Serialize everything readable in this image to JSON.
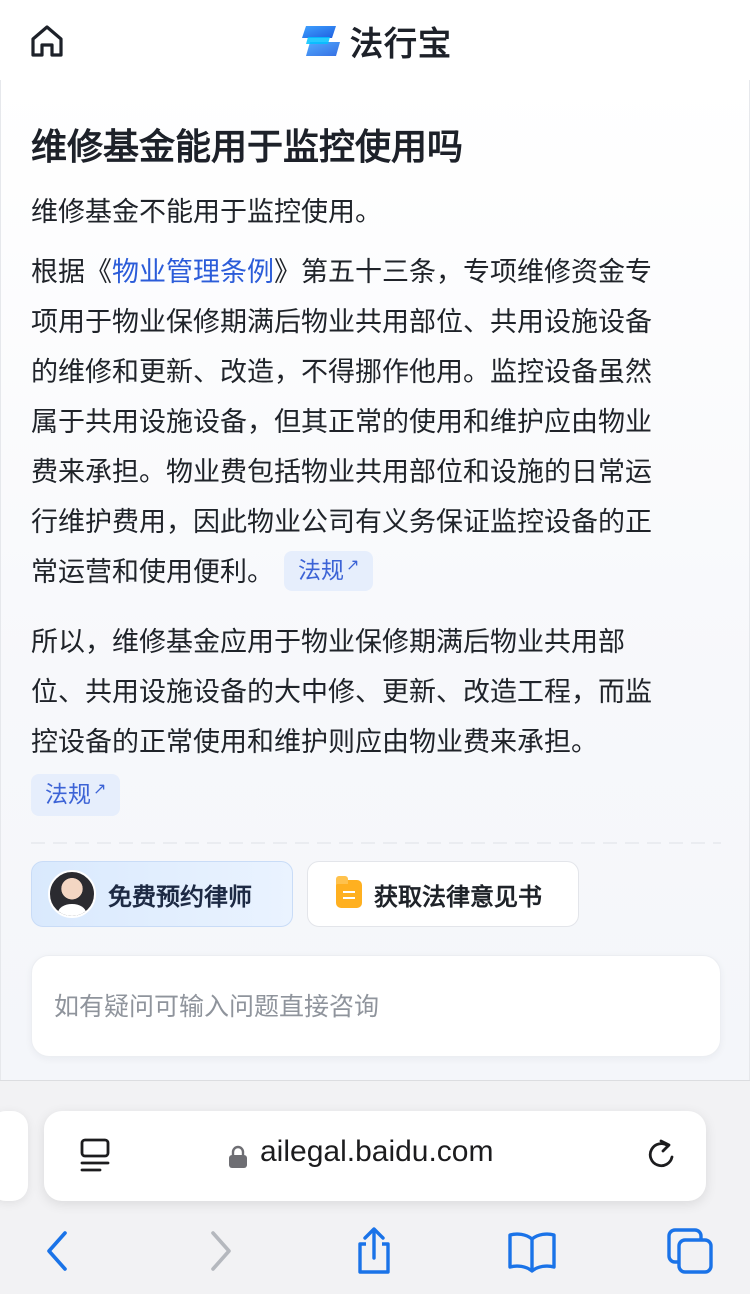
{
  "header": {
    "brand_name": "法行宝"
  },
  "article": {
    "title": "维修基金能用于监控使用吗",
    "summary": "维修基金不能用于监控使用。",
    "paragraph1": {
      "line1_prefix": "根据《",
      "law_link": "物业管理条例",
      "line1_suffix": "》第五十三条，专项维修资金专",
      "line2": "项用于物业保修期满后物业共用部位、共用设施设备",
      "line3": "的维修和更新、改造，不得挪作他用。监控设备虽然",
      "line4": "属于共用设施设备，但其正常的使用和维护应由物业",
      "line5": "费来承担。物业费包括物业共用部位和设施的日常运",
      "line6": "行维护费用，因此物业公司有义务保证监控设备的正",
      "line7": "常运营和使用便利。",
      "tag": "法规"
    },
    "paragraph2": {
      "line1": "所以，维修基金应用于物业保修期满后物业共用部",
      "line2": "位、共用设施设备的大中修、更新、改造工程，而监",
      "line3": "控设备的正常使用和维护则应由物业费来承担。",
      "tag": "法规"
    }
  },
  "actions": {
    "lawyer_button": "免费预约律师",
    "opinion_button": "获取法律意见书"
  },
  "ask": {
    "placeholder": "如有疑问可输入问题直接咨询"
  },
  "browser": {
    "url": "ailegal.baidu.com"
  },
  "icons": {
    "home": "home-icon",
    "reader": "reader-mode-icon",
    "lock": "lock-icon",
    "reload": "reload-icon",
    "back": "chevron-left-icon",
    "forward": "chevron-right-icon",
    "share": "share-icon",
    "bookmarks": "book-icon",
    "tabs": "tabs-icon"
  },
  "colors": {
    "link": "#2b5cd9",
    "tag_bg": "#e6eefc",
    "browser_accent": "#1a73e8"
  }
}
